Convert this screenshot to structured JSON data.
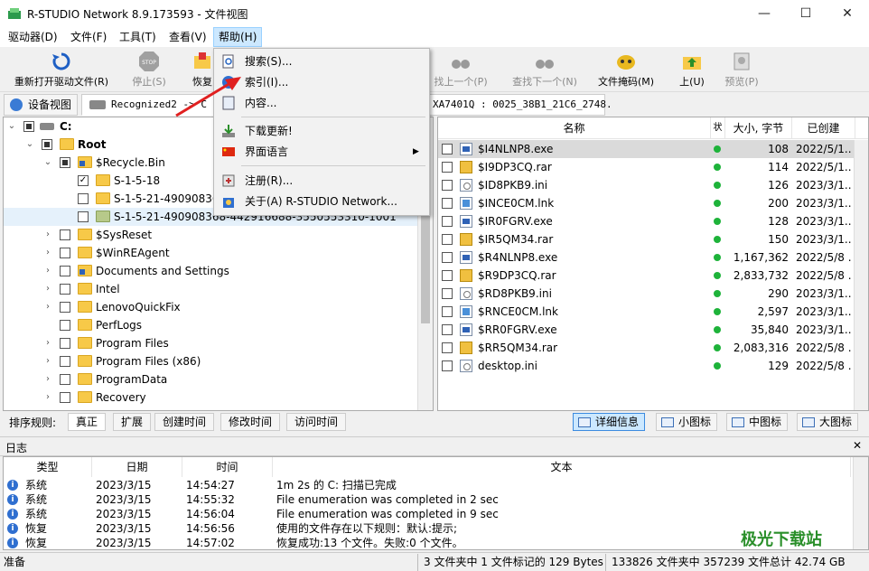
{
  "window": {
    "title": "R-STUDIO Network 8.9.173593 - 文件视图",
    "minimize": "—",
    "maximize": "☐",
    "close": "✕"
  },
  "menu": {
    "items": [
      "驱动器(D)",
      "文件(F)",
      "工具(T)",
      "查看(V)",
      "帮助(H)"
    ]
  },
  "toolbar": {
    "reopen": "重新打开驱动文件(R)",
    "stop": "停止(S)",
    "recover": "恢复",
    "find_prev": "找上一个(P)",
    "find_next": "查找下一个(N)",
    "file_mask": "文件掩码(M)",
    "up": "上(U)",
    "preview": "预览(P)",
    "stop_text": "STOP"
  },
  "tabs": {
    "device_view": "设备视图",
    "recognized": "Recognized2 -> C",
    "partial_path": "XA7401Q : 0025_38B1_21C6_2748."
  },
  "tree": {
    "drive": "C:",
    "items": [
      "Root",
      "$Recycle.Bin",
      "S-1-5-18",
      "S-1-5-21-49090836",
      "S-1-5-21-490908368-442916688-3550553310-1001",
      "$SysReset",
      "$WinREAgent",
      "Documents and Settings",
      "Intel",
      "LenovoQuickFix",
      "PerfLogs",
      "Program Files",
      "Program Files (x86)",
      "ProgramData",
      "Recovery"
    ]
  },
  "files": {
    "columns": {
      "name": "名称",
      "state": "状",
      "size": "大小, 字节",
      "created": "已创建"
    },
    "rows": [
      {
        "name": "$I4NLNP8.exe",
        "size": "108",
        "created": "2022/5/1..."
      },
      {
        "name": "$I9DP3CQ.rar",
        "size": "114",
        "created": "2022/5/1..."
      },
      {
        "name": "$ID8PKB9.ini",
        "size": "126",
        "created": "2023/3/1..."
      },
      {
        "name": "$INCE0CM.lnk",
        "size": "200",
        "created": "2023/3/1..."
      },
      {
        "name": "$IR0FGRV.exe",
        "size": "128",
        "created": "2023/3/1..."
      },
      {
        "name": "$IR5QM34.rar",
        "size": "150",
        "created": "2023/3/1..."
      },
      {
        "name": "$R4NLNP8.exe",
        "size": "1,167,362",
        "created": "2022/5/8 ..."
      },
      {
        "name": "$R9DP3CQ.rar",
        "size": "2,833,732",
        "created": "2022/5/8 ..."
      },
      {
        "name": "$RD8PKB9.ini",
        "size": "290",
        "created": "2023/3/1..."
      },
      {
        "name": "$RNCE0CM.lnk",
        "size": "2,597",
        "created": "2023/3/1..."
      },
      {
        "name": "$RR0FGRV.exe",
        "size": "35,840",
        "created": "2023/3/1..."
      },
      {
        "name": "$RR5QM34.rar",
        "size": "2,083,316",
        "created": "2022/5/8 ..."
      },
      {
        "name": "desktop.ini",
        "size": "129",
        "created": "2022/5/8 ..."
      }
    ]
  },
  "sortbar": {
    "label": "排序规则:",
    "tabs": [
      "真正",
      "扩展",
      "创建时间",
      "修改时间",
      "访问时间"
    ]
  },
  "views": {
    "details": "详细信息",
    "small": "小图标",
    "medium": "中图标",
    "large": "大图标"
  },
  "log": {
    "title": "日志",
    "close": "✕",
    "columns": {
      "type": "类型",
      "date": "日期",
      "time": "时间",
      "text": "文本"
    },
    "rows": [
      {
        "type": "系统",
        "date": "2023/3/15",
        "time": "14:54:27",
        "text": "1m 2s 的 C: 扫描已完成"
      },
      {
        "type": "系统",
        "date": "2023/3/15",
        "time": "14:55:32",
        "text": "File enumeration was completed in 2 sec"
      },
      {
        "type": "系统",
        "date": "2023/3/15",
        "time": "14:56:04",
        "text": "File enumeration was completed in 9 sec"
      },
      {
        "type": "恢复",
        "date": "2023/3/15",
        "time": "14:56:56",
        "text": "使用的文件存在以下规则：默认:提示;"
      },
      {
        "type": "恢复",
        "date": "2023/3/15",
        "time": "14:57:02",
        "text": "恢复成功:13 个文件。失败:0 个文件。"
      }
    ]
  },
  "status": {
    "ready": "准备",
    "selection": "3 文件夹中 1 文件标记的 129 Bytes",
    "totals": "133826 文件夹中 357239 文件总计 42.74 GB"
  },
  "help_menu": {
    "search": "搜索(S)...",
    "index": "索引(I)...",
    "contents": "内容...",
    "download": "下载更新!",
    "language": "界面语言",
    "register": "注册(R)...",
    "about": "关于(A) R-STUDIO Network..."
  },
  "watermark": "极光下载站",
  "colors": {
    "accent": "#0078d7",
    "selected_menu": "#cce8ff",
    "green_state": "#1eb33a",
    "red_arrow": "#e02020"
  }
}
